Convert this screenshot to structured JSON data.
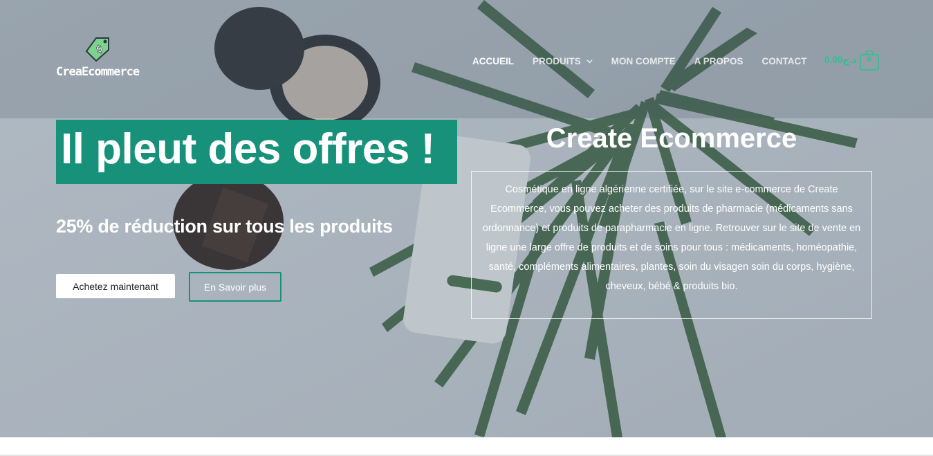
{
  "brand": {
    "logo_text": "CreaEcommerce",
    "logo_icon": "price-tag-dollar-icon"
  },
  "nav": {
    "items": [
      {
        "label": "ACCUEIL",
        "active": true
      },
      {
        "label": "PRODUITS",
        "has_dropdown": true
      },
      {
        "label": "MON COMPTE"
      },
      {
        "label": "A PROPOS"
      },
      {
        "label": "CONTACT"
      }
    ]
  },
  "cart": {
    "price": "0.00د.ج",
    "count": "0",
    "icon": "shopping-bag-icon"
  },
  "hero": {
    "title": "Il pleut des offres  !",
    "subtitle": "25% de réduction sur tous les produits",
    "primary_button": "Achetez maintenant",
    "secondary_button": "En Savoir plus",
    "brand_title": "Create Ecommerce",
    "description": "Cosmétique en ligne algérienne certifiée, sur le site e-commerce de Create Ecommerce, vous pouvez acheter des produits de pharmacie (médicaments sans ordonnance) et produits de parapharmacie en ligne. Retrouver sur le site de vente en ligne une large offre de produits et de soins pour tous : médicaments, homéopathie, santé, compléments alimentaires, plantes, soin du visagen soin du corps, hygiène, cheveux, bébé & produits bio."
  },
  "colors": {
    "accent": "#17917a",
    "cart_green": "#2fbf8e",
    "text": "#ffffff"
  }
}
